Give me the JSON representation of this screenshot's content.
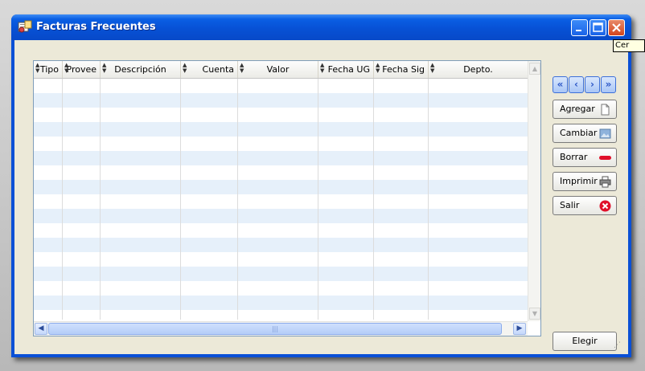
{
  "window": {
    "title": "Facturas Frecuentes"
  },
  "title_buttons": {
    "minimize": "minimize-icon",
    "maximize": "maximize-icon",
    "close": "close-icon"
  },
  "tooltip": "Cer",
  "grid": {
    "columns": [
      "Tipo",
      "Provee",
      "Descripción",
      "Cuenta",
      "Valor",
      "Fecha UG",
      "Fecha Sig",
      "Depto."
    ],
    "rows": []
  },
  "nav": {
    "first": "«",
    "prev": "‹",
    "next": "›",
    "last": "»"
  },
  "actions": {
    "agregar": "Agregar",
    "cambiar": "Cambiar",
    "borrar": "Borrar",
    "imprimir": "Imprimir",
    "salir": "Salir",
    "elegir": "Elegir"
  },
  "scroll": {
    "thumb_grip": "|||"
  }
}
